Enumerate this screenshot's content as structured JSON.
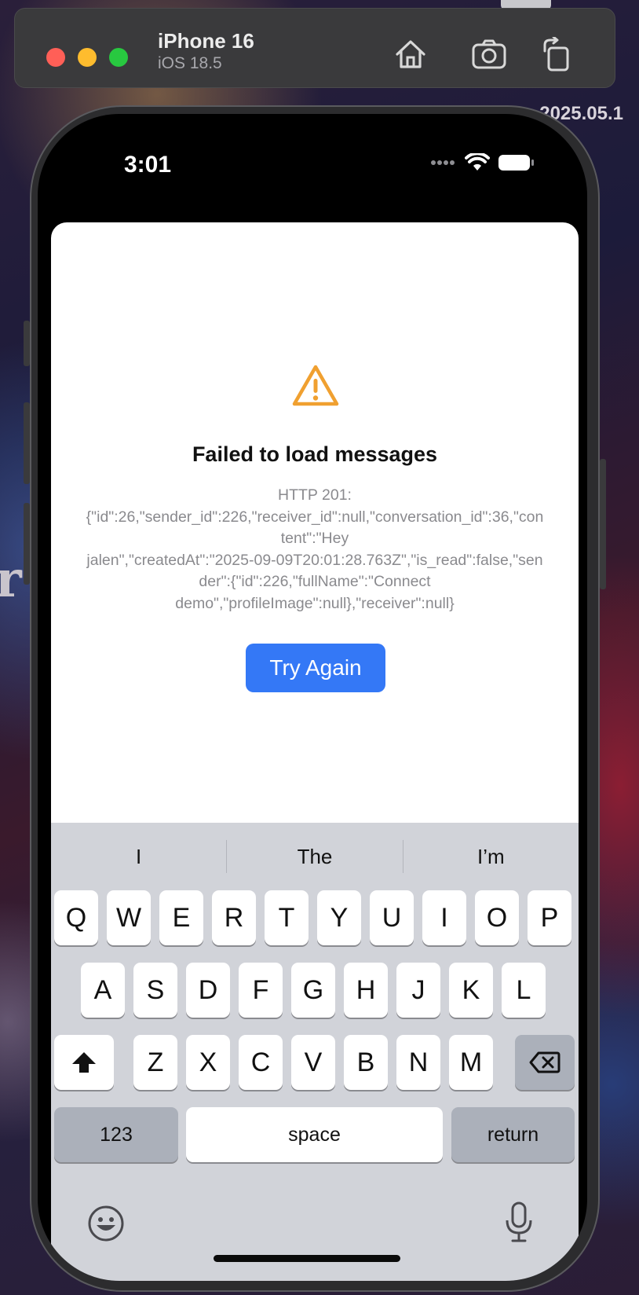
{
  "simulator": {
    "device_name": "iPhone 16",
    "os_version": "iOS 18.5"
  },
  "desktop": {
    "stamp_text": "2025.05.1",
    "partial_letter": "r"
  },
  "status_bar": {
    "time": "3:01"
  },
  "error": {
    "icon": "warning-triangle-icon",
    "title": "Failed to load messages",
    "message": "HTTP 201:\n{\"id\":26,\"sender_id\":226,\"receiver_id\":null,\"conversation_id\":36,\"con\ntent\":\"Hey\njalen\",\"createdAt\":\"2025-09-09T20:01:28.763Z\",\"is_read\":false,\"sen\nder\":{\"id\":226,\"fullName\":\"Connect\ndemo\",\"profileImage\":null},\"receiver\":null}",
    "button_label": "Try Again",
    "accent_color": "#3478f6",
    "warning_color": "#f0a030"
  },
  "keyboard": {
    "suggestions": [
      "I",
      "The",
      "I’m"
    ],
    "row1": [
      "Q",
      "W",
      "E",
      "R",
      "T",
      "Y",
      "U",
      "I",
      "O",
      "P"
    ],
    "row2": [
      "A",
      "S",
      "D",
      "F",
      "G",
      "H",
      "J",
      "K",
      "L"
    ],
    "row3": [
      "Z",
      "X",
      "C",
      "V",
      "B",
      "N",
      "M"
    ],
    "numbers_label": "123",
    "space_label": "space",
    "return_label": "return"
  }
}
